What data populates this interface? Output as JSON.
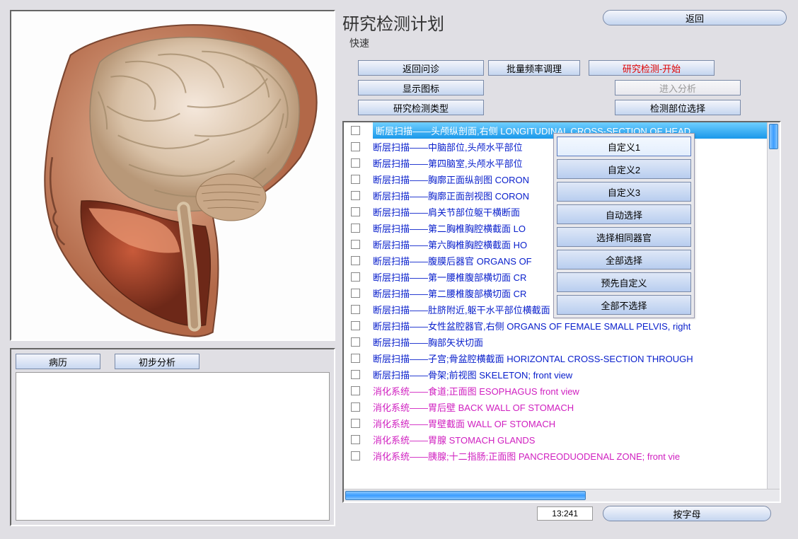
{
  "header": {
    "title": "研究检测计划",
    "subtitle": "快速",
    "back_button": "返回"
  },
  "toolbar": {
    "row1": {
      "return_consult": "返回问诊",
      "batch_freq": "批量频率调理",
      "start_research": "研究检测-开始"
    },
    "row2": {
      "show_icon": "显示图标",
      "enter_analysis": "进入分析"
    },
    "row3": {
      "research_type": "研究检测类型",
      "region_select": "检测部位选择"
    }
  },
  "tabs": {
    "history": "病历",
    "prelim_analysis": "初步分析"
  },
  "context_menu": {
    "items": [
      "自定义1",
      "自定义2",
      "自定义3",
      "自动选择",
      "选择相同器官",
      "全部选择",
      "预先自定义",
      "全部不选择"
    ]
  },
  "list": {
    "items": [
      {
        "text": "断层扫描——头颅纵剖面,右侧 LONGITUDINAL CROSS-SECTION OF HEAD",
        "color": "blue",
        "selected": true
      },
      {
        "text": "断层扫描——中脑部位,头颅水平部位",
        "color": "blue"
      },
      {
        "text": "断层扫描——第四脑室,头颅水平部位",
        "color": "blue"
      },
      {
        "text": "断层扫描——胸廓正面纵剖图 CORON",
        "color": "blue"
      },
      {
        "text": "断层扫描——胸廓正面剖视图 CORON",
        "color": "blue"
      },
      {
        "text": "断层扫描——肩关节部位躯干横断面",
        "color": "blue"
      },
      {
        "text": "断层扫描——第二胸椎胸腔横截面 LO",
        "color": "blue"
      },
      {
        "text": "断层扫描——第六胸椎胸腔横截面 HO",
        "color": "blue"
      },
      {
        "text": "断层扫描——腹膜后器官 ORGANS OF",
        "color": "blue"
      },
      {
        "text": "断层扫描——第一腰椎腹部横切面 CR",
        "color": "blue"
      },
      {
        "text": "断层扫描——第二腰椎腹部横切面 CR",
        "color": "blue"
      },
      {
        "text": "断层扫描——肚脐附近,躯干水平部位横截面 HORIZONTAL CROSS-SECTION",
        "color": "blue"
      },
      {
        "text": "断层扫描——女性盆腔器官,右侧 ORGANS OF FEMALE SMALL PELVIS, right",
        "color": "blue"
      },
      {
        "text": "断层扫描——胸部矢状切面",
        "color": "blue"
      },
      {
        "text": "断层扫描——子宫;骨盆腔横截面 HORIZONTAL CROSS-SECTION THROUGH",
        "color": "blue"
      },
      {
        "text": "断层扫描——骨架;前视图 SKELETON;  front  view",
        "color": "blue"
      },
      {
        "text": "消化系统——食道;正面图 ESOPHAGUS    front  view",
        "color": "magenta"
      },
      {
        "text": "消化系统——胃后壁 BACK WALL OF STOMACH",
        "color": "magenta"
      },
      {
        "text": "消化系统——胃壁截面 WALL OF STOMACH",
        "color": "magenta"
      },
      {
        "text": "消化系统——胃腺 STOMACH  GLANDS",
        "color": "magenta"
      },
      {
        "text": "消化系统——胰腺;十二指肠;正面图 PANCREODUODENAL  ZONE;  front  vie",
        "color": "magenta"
      }
    ]
  },
  "footer": {
    "counter": "13:241",
    "sort_button": "按字母"
  }
}
